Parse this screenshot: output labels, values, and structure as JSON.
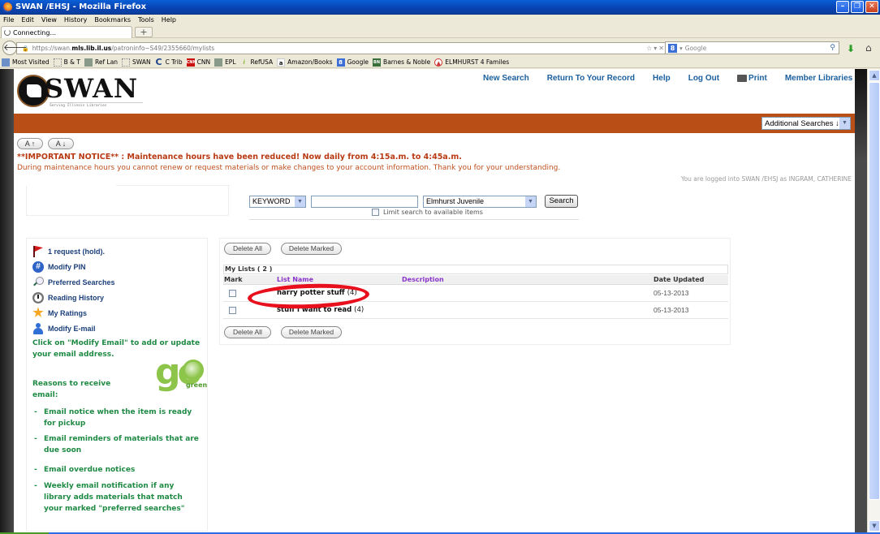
{
  "window": {
    "title": "SWAN /EHSJ - Mozilla Firefox",
    "controls": [
      "minimize",
      "restore",
      "close"
    ]
  },
  "menubar": [
    "File",
    "Edit",
    "View",
    "History",
    "Bookmarks",
    "Tools",
    "Help"
  ],
  "tab": {
    "label": "Connecting...",
    "new_tab_label": "+"
  },
  "navbar": {
    "url_prefix": "https://swan.",
    "url_domain": "mls.lib.il.us",
    "url_path": "/patroninfo~S49/2355660/mylists",
    "search_engine_placeholder": "Google"
  },
  "bookmarks": [
    {
      "label": "Most Visited",
      "icon": "folder-icon"
    },
    {
      "label": "B & T",
      "icon": "page-icon"
    },
    {
      "label": "Ref Lan",
      "icon": "image-icon"
    },
    {
      "label": "SWAN",
      "icon": "page-icon"
    },
    {
      "label": "C Trib",
      "icon": "ctrib-icon"
    },
    {
      "label": "CNN",
      "icon": "cnn-icon"
    },
    {
      "label": "EPL",
      "icon": "image-icon"
    },
    {
      "label": "RefUSA",
      "icon": "info-icon"
    },
    {
      "label": "Amazon/Books",
      "icon": "amazon-icon"
    },
    {
      "label": "Google",
      "icon": "google-icon"
    },
    {
      "label": "Barnes & Noble",
      "icon": "bn-icon"
    },
    {
      "label": "ELMHURST 4 Familes",
      "icon": "elmhurst-icon"
    }
  ],
  "header": {
    "logo_word": "SWAN",
    "logo_tagline": "Serving Illinois Libraries",
    "nav": [
      "New Search",
      "Return To Your Record",
      "Help",
      "Log Out",
      "Print",
      "Member Libraries"
    ],
    "additional_searches": "Additional Searches ↓"
  },
  "font_buttons": [
    "A ↑",
    "A ↓"
  ],
  "notice": {
    "headline": "**IMPORTANT NOTICE** : Maintenance hours have been reduced! Now daily from 4:15a.m. to 4:45a.m.",
    "detail": "During maintenance hours you cannot renew or request materials or make changes to your account information. Thank you for your understanding."
  },
  "logged_in": "You are logged into SWAN /EHSJ as INGRAM, CATHERINE",
  "search": {
    "type": "KEYWORD",
    "query": "",
    "scope": "Elmhurst Juvenile",
    "button": "Search",
    "limit_label": "Limit search to available items",
    "limit_checked": false
  },
  "sidebar": {
    "items": [
      {
        "label": "1 request (hold).",
        "icon": "flag-icon"
      },
      {
        "label": "Modify PIN",
        "icon": "hash-icon"
      },
      {
        "label": "Preferred Searches",
        "icon": "magnifier-icon"
      },
      {
        "label": "Reading History",
        "icon": "clock-icon"
      },
      {
        "label": "My Ratings",
        "icon": "star-icon"
      },
      {
        "label": "Modify E-mail",
        "icon": "person-icon"
      }
    ],
    "email_prompt": "Click on \"Modify Email\" to add or update your email address.",
    "reasons_title": "Reasons to receive email:",
    "gogreen": {
      "big": "go",
      "small": "green"
    },
    "reasons": [
      "Email notice when the item is ready for pickup",
      "Email reminders of materials that are due soon",
      "Email overdue notices",
      "Weekly email notification if any library adds materials that match your marked \"preferred searches\""
    ]
  },
  "lists": {
    "delete_all": "Delete All",
    "delete_marked": "Delete Marked",
    "heading": "My Lists ( 2 )",
    "columns": [
      "Mark",
      "List Name",
      "Description",
      "Date Updated"
    ],
    "rows": [
      {
        "name": "harry potter stuff",
        "count": "(4)",
        "description": "",
        "date": "05-13-2013",
        "marked": false,
        "highlighted": true
      },
      {
        "name": "stuff i want to read",
        "count": "(4)",
        "description": "",
        "date": "05-13-2013",
        "marked": false,
        "highlighted": false
      }
    ]
  },
  "colors": {
    "orange_bar": "#b94e17",
    "notice_red": "#b83a12",
    "nav_blue": "#1a5f9e",
    "sidebar_green": "#1f8a44",
    "annotation_red": "#e8101c",
    "column_purple": "#8a35c9"
  }
}
